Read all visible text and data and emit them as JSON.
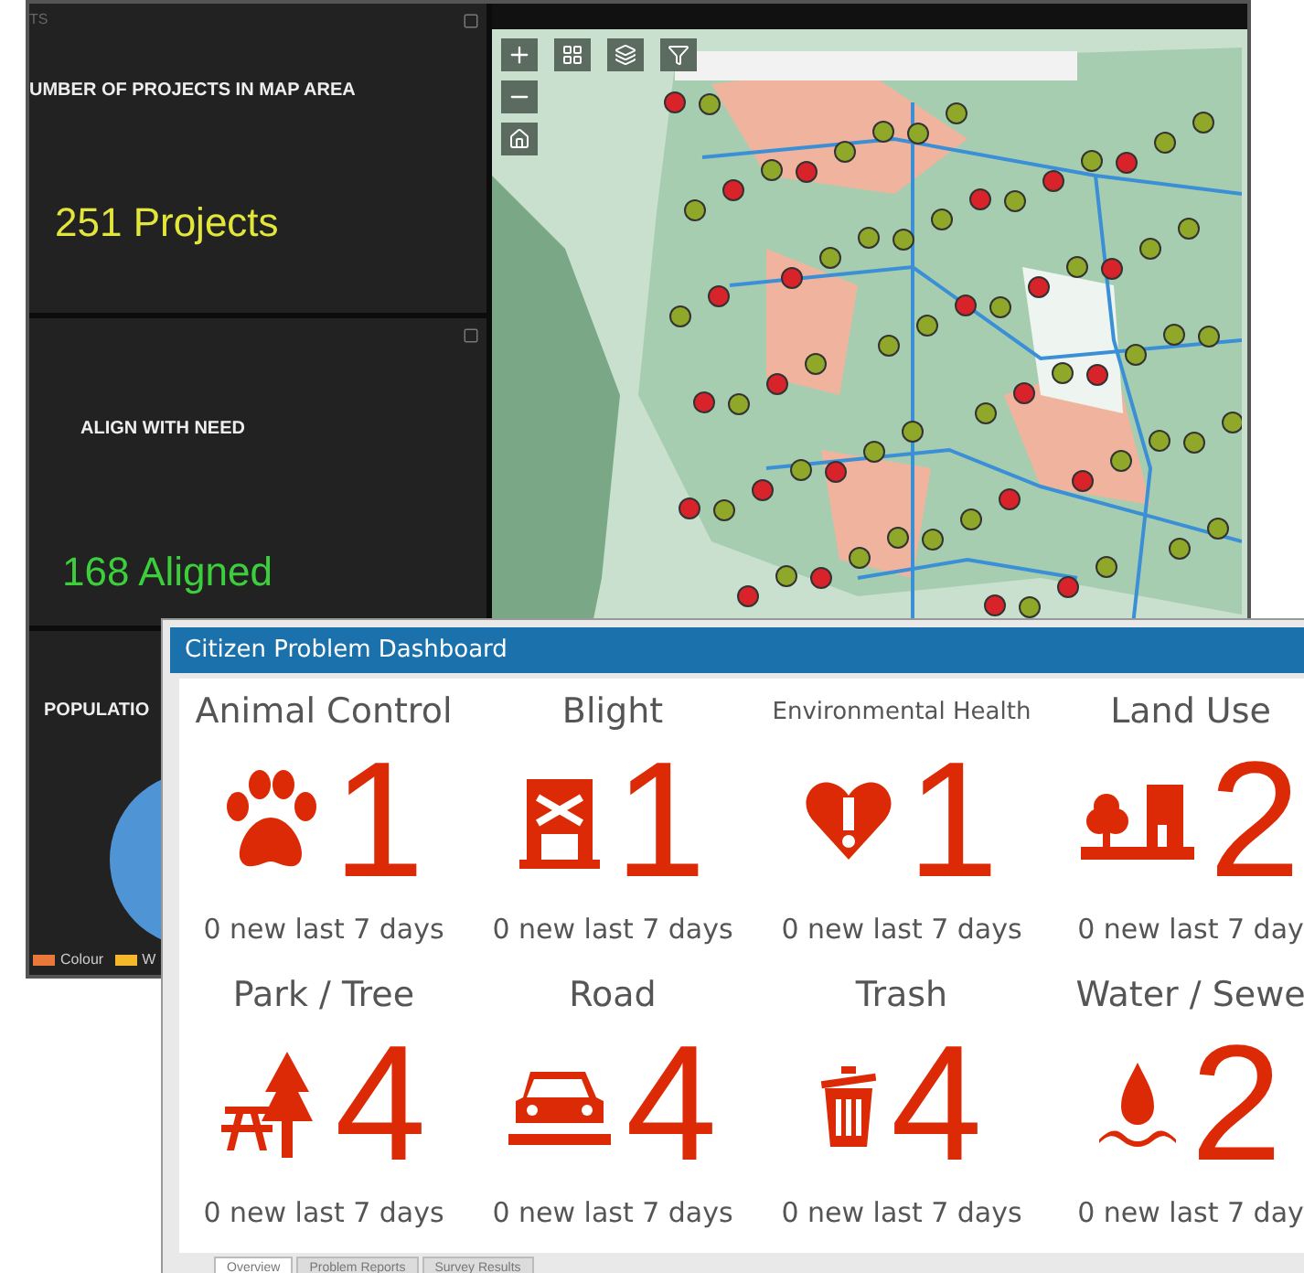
{
  "back_window": {
    "header": "TS",
    "panels": [
      {
        "kind": "indicator",
        "title": "UMBER OF PROJECTS IN MAP AREA",
        "value": "251 Projects",
        "color": "#e3e63a"
      },
      {
        "kind": "indicator",
        "title": "ALIGN WITH NEED",
        "value": "168 Aligned",
        "color": "#3ccf3c"
      },
      {
        "kind": "pie",
        "title": "POPULATIO",
        "legend": [
          {
            "label": "Colour",
            "color": "#e8793a"
          },
          {
            "label": "W",
            "color": "#f5b82a"
          }
        ]
      }
    ]
  },
  "dashboard": {
    "title": "Citizen Problem Dashboard",
    "tiles": [
      {
        "kind": "paw",
        "label": "Animal Control",
        "count": "1",
        "note": "0 new last 7 days"
      },
      {
        "kind": "blight",
        "label": "Blight",
        "count": "1",
        "note": "0 new last 7 days"
      },
      {
        "kind": "heart",
        "label": "Environmental Health",
        "count": "1",
        "note": "0 new last 7 days"
      },
      {
        "kind": "landuse",
        "label": "Land Use",
        "count": "2",
        "note": "0 new last 7 day"
      },
      {
        "kind": "park",
        "label": "Park / Tree",
        "count": "4",
        "note": "0 new last 7 days"
      },
      {
        "kind": "road",
        "label": "Road",
        "count": "4",
        "note": "0 new last 7 days"
      },
      {
        "kind": "trash",
        "label": "Trash",
        "count": "4",
        "note": "0 new last 7 days"
      },
      {
        "kind": "water",
        "label": "Water / Sewe",
        "count": "2",
        "note": "0 new last 7 day"
      }
    ],
    "tabs": [
      {
        "label": "Overview",
        "selected": true
      },
      {
        "label": "Problem Reports",
        "selected": false
      },
      {
        "label": "Survey Results",
        "selected": false
      }
    ]
  }
}
